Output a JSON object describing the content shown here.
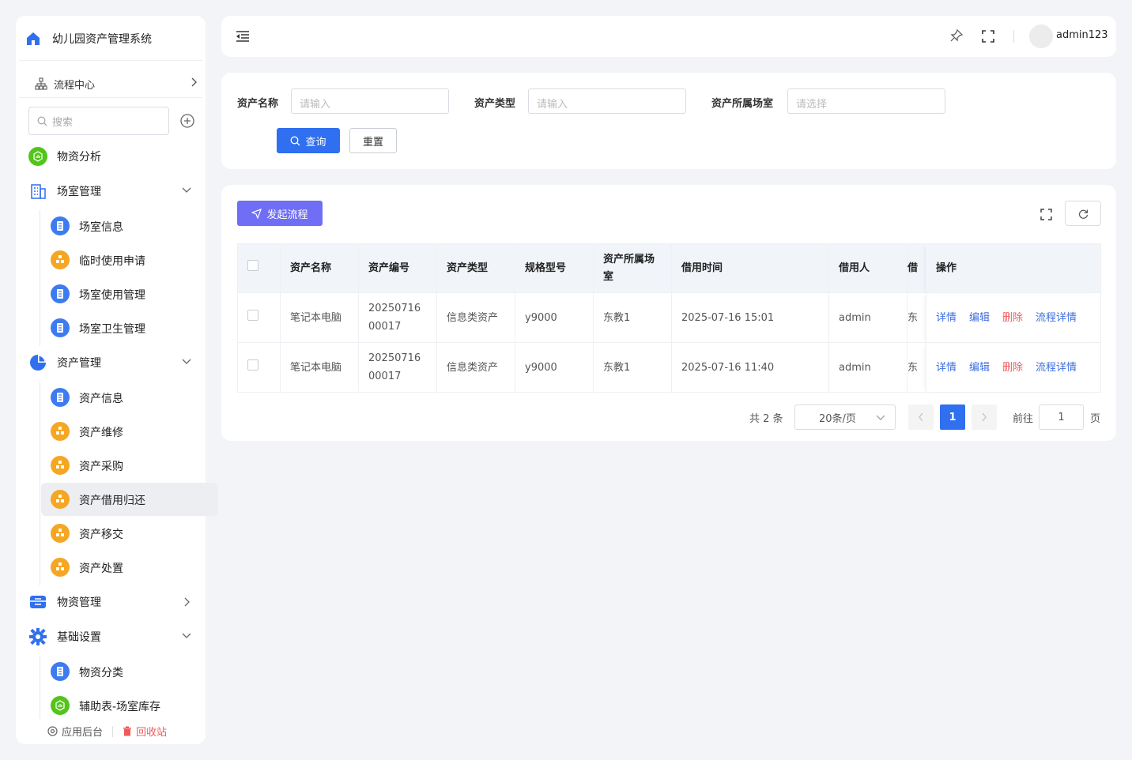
{
  "sidebar": {
    "brand": "幼儿园资产管理系统",
    "flow_center": "流程中心",
    "search_placeholder": "搜索",
    "menu": {
      "analysis": "物资分析",
      "room_mgmt": "场室管理",
      "room_info": "场室信息",
      "temp_apply": "临时使用申请",
      "room_usage": "场室使用管理",
      "room_hygiene": "场室卫生管理",
      "asset_mgmt": "资产管理",
      "asset_info": "资产信息",
      "asset_repair": "资产维修",
      "asset_purchase": "资产采购",
      "asset_borrow": "资产借用归还",
      "asset_transfer": "资产移交",
      "asset_dispose": "资产处置",
      "material_mgmt": "物资管理",
      "basic_settings": "基础设置",
      "material_category": "物资分类",
      "aux_room_stock": "辅助表-场室库存"
    },
    "footer": {
      "backend": "应用后台",
      "recycle": "回收站"
    }
  },
  "topbar": {
    "username": "admin123"
  },
  "filter": {
    "asset_name_label": "资产名称",
    "asset_name_placeholder": "请输入",
    "asset_type_label": "资产类型",
    "asset_type_placeholder": "请输入",
    "room_label": "资产所属场室",
    "room_placeholder": "请选择",
    "query_label": "查询",
    "reset_label": "重置"
  },
  "table": {
    "start_flow_label": "发起流程",
    "columns": {
      "name": "资产名称",
      "code": "资产编号",
      "type": "资产类型",
      "model": "规格型号",
      "room": "资产所属场室",
      "time": "借用时间",
      "borrower": "借用人",
      "next": "借",
      "ops": "操作"
    },
    "rows": [
      {
        "name": "笔记本电脑",
        "code": "2025071600017",
        "type": "信息类资产",
        "model": "y9000",
        "room": "东教1",
        "time": "2025-07-16 15:01",
        "borrower": "admin",
        "next": "东"
      },
      {
        "name": "笔记本电脑",
        "code": "2025071600017",
        "type": "信息类资产",
        "model": "y9000",
        "room": "东教1",
        "time": "2025-07-16 11:40",
        "borrower": "admin",
        "next": "东"
      }
    ],
    "actions": {
      "detail": "详情",
      "edit": "编辑",
      "delete": "删除",
      "flow_detail": "流程详情"
    }
  },
  "pagination": {
    "total": "共 2 条",
    "page_size": "20条/页",
    "current": "1",
    "goto_label": "前往",
    "goto_value": "1",
    "page_suffix": "页"
  },
  "colors": {
    "primary": "#2f6ff0",
    "accent": "#6f6ef5",
    "danger": "#f05a5a",
    "green": "#52c41a",
    "orange": "#f5a623"
  }
}
